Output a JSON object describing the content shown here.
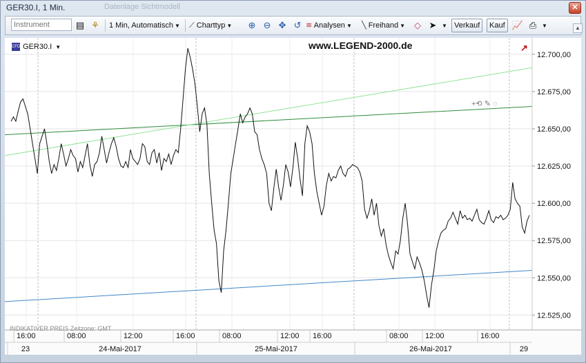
{
  "window": {
    "title": "GER30.I, 1 Min.",
    "ghost_text": "Datenlage   Sichtmodell"
  },
  "toolbar": {
    "instrument_placeholder": "Instrument",
    "timeframe_label": "1 Min,  Automatisch",
    "charttype_label": "Charttyp",
    "analysen_label": "Analysen",
    "freihand_label": "Freihand",
    "verkauf_label": "Verkauf",
    "kauf_label": "Kauf"
  },
  "chart": {
    "symbol": "GER30.I",
    "cfd_badge": "CFD",
    "watermark": "www.LEGEND-2000.de",
    "footer_note": "INDIKATIVER PREIS   Zeitzone: GMT",
    "tool_icons_text": "+⟲ ✎ ◌",
    "y_ticks": [
      "12.700,00",
      "12.675,00",
      "12.650,00",
      "12.625,00",
      "12.600,00",
      "12.575,00",
      "12.550,00",
      "12.525,00"
    ],
    "time_labels": [
      "16:00",
      "08:00",
      "12:00",
      "16:00",
      "08:00",
      "12:00",
      "16:00",
      "08:00",
      "12:00",
      "16:00"
    ],
    "date_labels": [
      "23",
      "24-Mai-2017",
      "25-Mai-2017",
      "26-Mai-2017",
      "29"
    ],
    "colors": {
      "price_line": "#111111",
      "trend_dark_green": "#2e8b3a",
      "trend_light_green": "#8ee39a",
      "trend_blue": "#3f86c8",
      "grid": "#d6d6d6",
      "session_separator": "#bdbdbd"
    }
  },
  "chart_data": {
    "type": "line",
    "title": "GER30.I, 1 Min.",
    "xlabel": "",
    "ylabel": "",
    "ylim": [
      12515,
      12711
    ],
    "grid": true,
    "time_axis": {
      "labels": [
        "16:00",
        "08:00",
        "12:00",
        "16:00",
        "08:00",
        "12:00",
        "16:00",
        "08:00",
        "12:00",
        "16:00"
      ],
      "dates": [
        "23",
        "24-Mai-2017",
        "25-Mai-2017",
        "26-Mai-2017",
        "29"
      ]
    },
    "series": [
      {
        "values": [
          12655,
          12658,
          12655,
          12662,
          12668,
          12670,
          12665,
          12660,
          12650,
          12640,
          12630,
          12620,
          12640,
          12645,
          12650,
          12640,
          12628,
          12620,
          12626,
          12622,
          12630,
          12640,
          12633,
          12625,
          12630,
          12636,
          12632,
          12630,
          12621,
          12628,
          12624,
          12632,
          12640,
          12626,
          12618,
          12626,
          12628,
          12634,
          12645,
          12636,
          12627,
          12634,
          12640,
          12644,
          12638,
          12630,
          12625,
          12624,
          12628,
          12624,
          12636,
          12630,
          12628,
          12626,
          12630,
          12640,
          12638,
          12628,
          12626,
          12634,
          12636,
          12627,
          12634,
          12622,
          12630,
          12628,
          12633,
          12626,
          12632,
          12636,
          12634,
          12650,
          12670,
          12690,
          12704,
          12698,
          12690,
          12680,
          12665,
          12648,
          12660,
          12664,
          12653,
          12620,
          12600,
          12582,
          12573,
          12548,
          12540,
          12568,
          12582,
          12600,
          12620,
          12630,
          12640,
          12650,
          12660,
          12654,
          12658,
          12660,
          12664,
          12660,
          12648,
          12646,
          12636,
          12630,
          12626,
          12620,
          12600,
          12595,
          12610,
          12623,
          12611,
          12602,
          12612,
          12626,
          12621,
          12611,
          12624,
          12641,
          12630,
          12616,
          12605,
          12640,
          12652,
          12648,
          12640,
          12620,
          12608,
          12600,
          12592,
          12598,
          12612,
          12620,
          12615,
          12618,
          12617,
          12622,
          12625,
          12620,
          12618,
          12623,
          12624,
          12626,
          12625,
          12624,
          12621,
          12615,
          12596,
          12590,
          12595,
          12603,
          12592,
          12600,
          12585,
          12578,
          12583,
          12572,
          12565,
          12560,
          12556,
          12568,
          12566,
          12575,
          12590,
          12600,
          12586,
          12566,
          12561,
          12556,
          12564,
          12560,
          12555,
          12548,
          12538,
          12530,
          12545,
          12555,
          12568,
          12575,
          12580,
          12582,
          12583,
          12588,
          12590,
          12594,
          12590,
          12586,
          12595,
          12590,
          12592,
          12589,
          12590,
          12588,
          12592,
          12596,
          12589,
          12587,
          12586,
          12590,
          12595,
          12589,
          12587,
          12591,
          12590,
          12592,
          12589,
          12590,
          12592,
          12596,
          12614,
          12603,
          12600,
          12598,
          12584,
          12580,
          12588,
          12592
        ],
        "color": "#111111"
      },
      {
        "line_type": "trendline",
        "y_start": 12646,
        "y_end": 12665,
        "color": "#2e8b3a"
      },
      {
        "line_type": "trendline",
        "y_start": 12632,
        "y_end": 12691,
        "color": "#8ee39a"
      },
      {
        "line_type": "trendline",
        "y_start": 12534,
        "y_end": 12555,
        "color": "#3f86c8"
      }
    ]
  }
}
